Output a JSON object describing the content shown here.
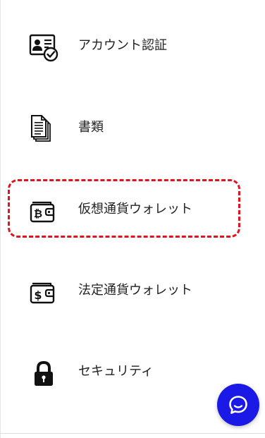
{
  "menu": {
    "items": [
      {
        "label": "アカウント認証",
        "icon": "id-card-check-icon"
      },
      {
        "label": "書類",
        "icon": "documents-icon"
      },
      {
        "label": "仮想通貨ウォレット",
        "icon": "bitcoin-wallet-icon",
        "highlighted": true
      },
      {
        "label": "法定通貨ウォレット",
        "icon": "dollar-wallet-icon"
      },
      {
        "label": "セキュリティ",
        "icon": "lock-icon"
      }
    ]
  },
  "colors": {
    "highlight_border": "#e0141e",
    "chat_button": "#1a19e6",
    "text": "#222222"
  },
  "chat": {
    "icon": "chat-bubble-icon"
  }
}
